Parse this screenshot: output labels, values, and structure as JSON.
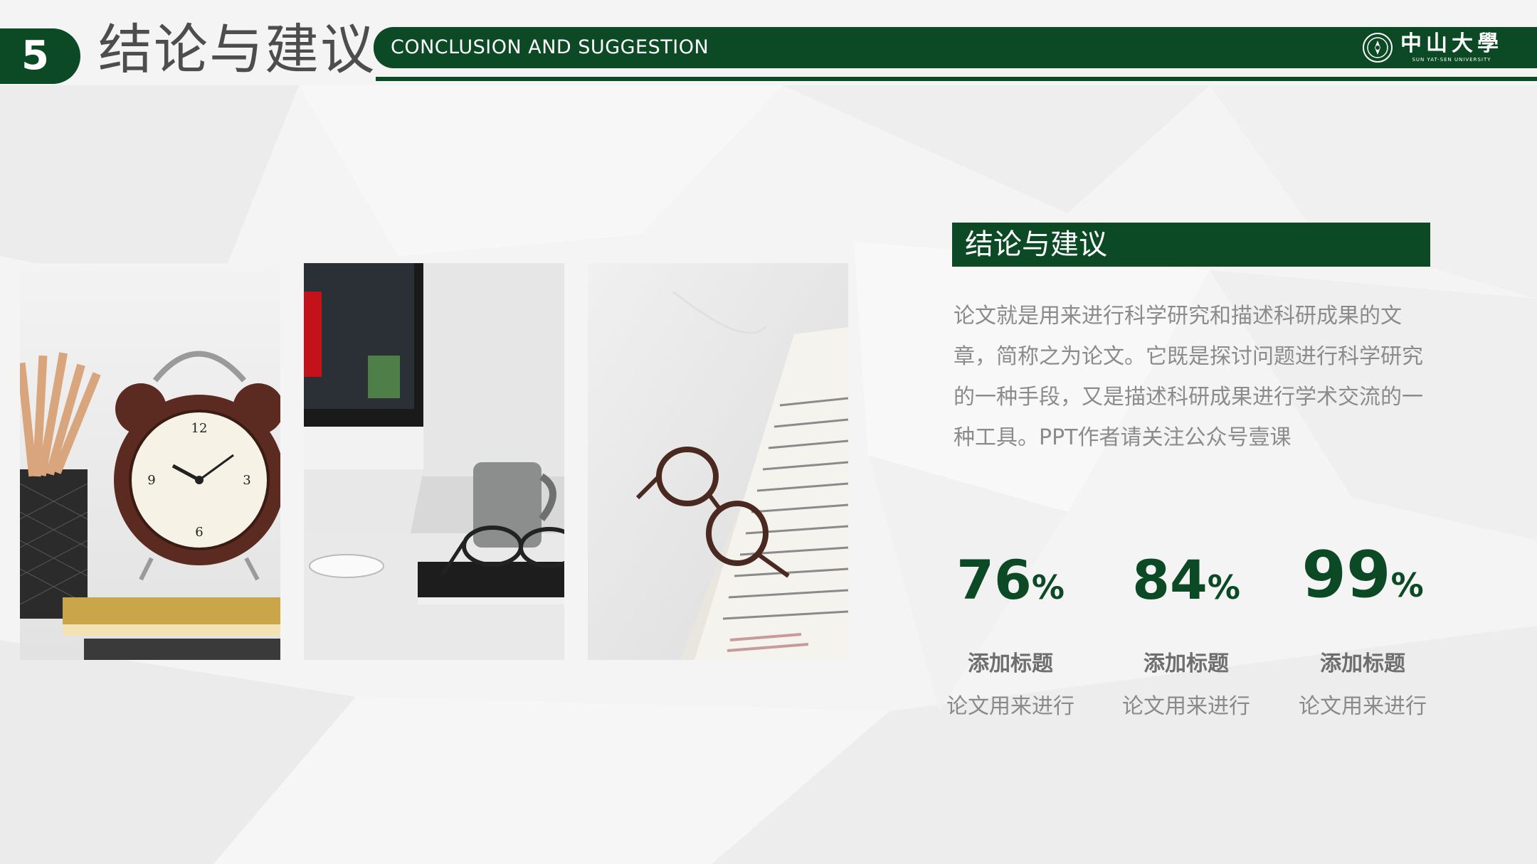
{
  "header": {
    "section_number": "5",
    "section_title": "结论与建议",
    "english_title": "CONCLUSION AND SUGGESTION",
    "logo": {
      "name": "中山大學",
      "subtitle": "SUN YAT-SEN UNIVERSITY",
      "icon": "university-emblem-icon"
    }
  },
  "photos": [
    {
      "name": "alarm-clock-pencils-photo"
    },
    {
      "name": "monitor-mug-glasses-photo"
    },
    {
      "name": "newspaper-glasses-photo"
    }
  ],
  "panel": {
    "title": "结论与建议",
    "body": "论文就是用来进行科学研究和描述科研成果的文章，简称之为论文。它既是探讨问题进行科学研究的一种手段，又是描述科研成果进行学术交流的一种工具。PPT作者请关注公众号壹课"
  },
  "stats": [
    {
      "value": "76",
      "unit": "%",
      "label": "添加标题",
      "desc": "论文用来进行"
    },
    {
      "value": "84",
      "unit": "%",
      "label": "添加标题",
      "desc": "论文用来进行"
    },
    {
      "value": "99",
      "unit": "%",
      "label": "添加标题",
      "desc": "论文用来进行"
    }
  ],
  "colors": {
    "brand_green": "#0c4a25",
    "body_text": "#8b8b8b",
    "background": "#f3f3f3"
  }
}
